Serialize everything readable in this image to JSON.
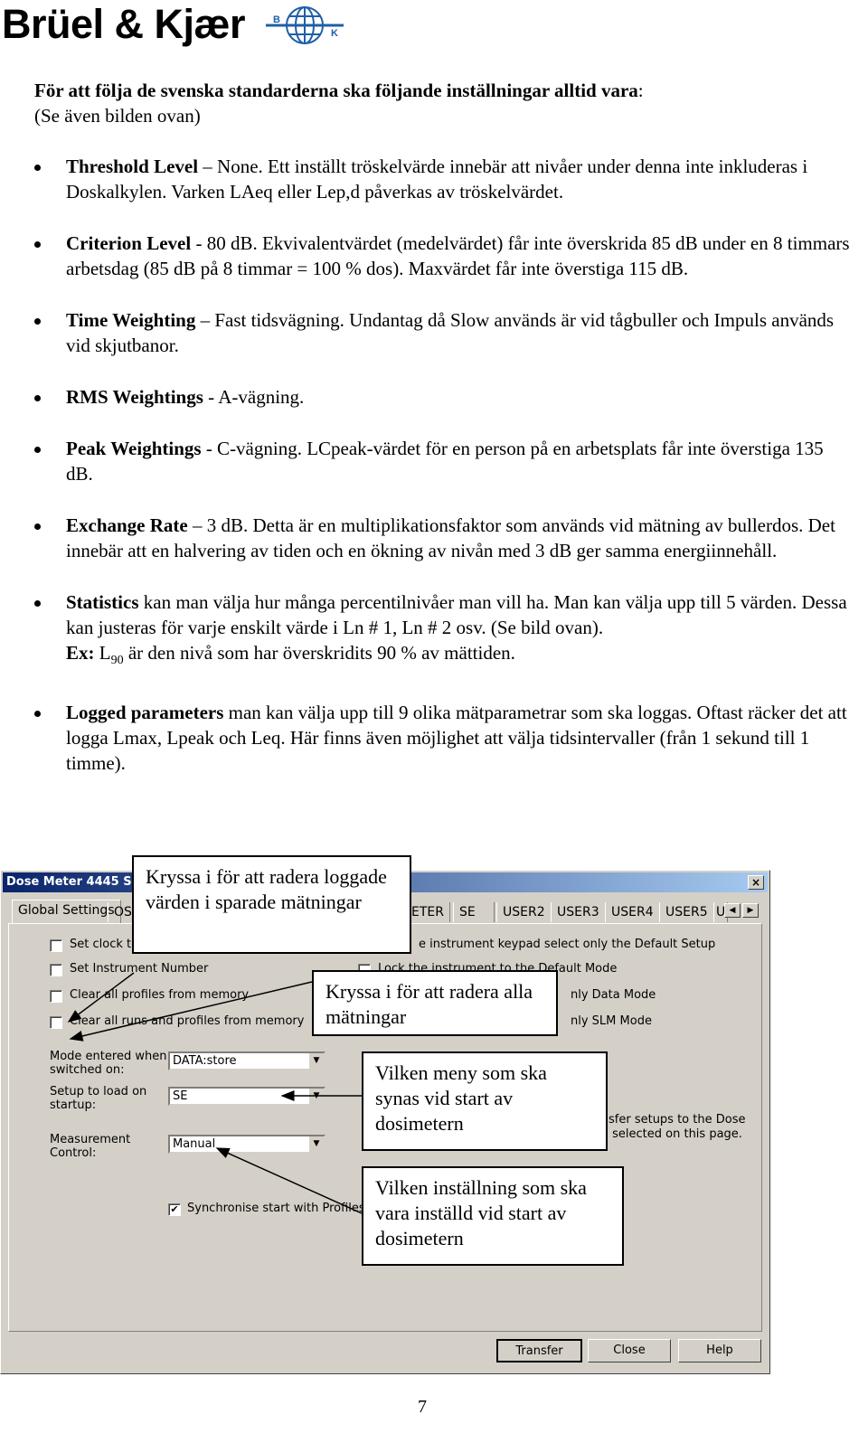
{
  "logo": {
    "text": "Brüel & Kjær",
    "mark_letters": "B K",
    "color": "#1f5fa8"
  },
  "intro": {
    "line1": "För att följa de svenska standarderna ska följande inställningar alltid vara",
    "line1_colon": ":",
    "line2": "(Se även bilden ovan)"
  },
  "bullets": [
    {
      "term": "Threshold Level",
      "text": " – None. Ett inställt tröskelvärde innebär att nivåer under denna inte inkluderas i Doskalkylen. Varken LAeq eller Lep,d påverkas av tröskelvärdet."
    },
    {
      "term": "Criterion Level",
      "text": " - 80 dB. Ekvivalentvärdet (medelvärdet) får inte överskrida 85 dB under en 8 timmars arbetsdag (85 dB på 8 timmar = 100 % dos). Maxvärdet får inte överstiga 115 dB."
    },
    {
      "term": "Time Weighting",
      "text": " – Fast tidsvägning. Undantag då Slow används är vid tågbuller och Impuls används vid skjutbanor."
    },
    {
      "term": "RMS Weightings",
      "text": " - A-vägning."
    },
    {
      "term": "Peak Weightings",
      "text": " - C-vägning. LCpeak-värdet för en person på en arbetsplats får inte överstiga 135 dB."
    },
    {
      "term": "Exchange Rate",
      "text": " – 3 dB. Detta är en multiplikationsfaktor som används vid mätning av bullerdos. Det innebär att en halvering av tiden och en ökning av nivån med 3 dB ger samma energiinnehåll."
    },
    {
      "term": "Statistics",
      "text": " kan man välja hur många percentilnivåer man vill ha. Man kan välja upp till 5 värden. Dessa kan justeras för varje enskilt värde i Ln # 1, Ln # 2 osv. (Se bild ovan).",
      "ex_label": "Ex:",
      "ex_L": " L",
      "ex_sub": "90",
      "ex_text": " är den nivå som har överskridits 90 % av mättiden."
    },
    {
      "term": "Logged parameters",
      "text": " man kan välja upp till 9 olika mätparametrar som ska loggas. Oftast räcker det att logga Lmax, Lpeak och Leq. Här finns även möjlighet att välja tidsintervaller (från 1 sekund till 1 timme)."
    }
  ],
  "dialog": {
    "title": "Dose Meter 4445 Se",
    "close_glyph": "×",
    "tabs": [
      "Global Settings",
      "OS",
      "ETER",
      "SE",
      "USER2",
      "USER3",
      "USER4",
      "USER5",
      "U"
    ],
    "scroll_left": "◀",
    "scroll_right": "▶",
    "left_checks": [
      {
        "label": "Set clock to",
        "checked": false
      },
      {
        "label": "Set Instrument Number",
        "checked": false
      },
      {
        "label": "Clear all profiles from memory",
        "checked": false
      },
      {
        "label": "Clear all runs and profiles from memory",
        "checked": false
      }
    ],
    "right_checks": [
      {
        "label": "e instrument keypad select only the Default Setup"
      },
      {
        "label": "Lock the instrument to the Default Mode"
      },
      {
        "label": "nly Data Mode"
      },
      {
        "label": "nly SLM Mode"
      }
    ],
    "fields": [
      {
        "label1": "Mode entered when",
        "label2": "switched on:",
        "value": "DATA:store"
      },
      {
        "label1": "Setup to load on",
        "label2": "startup:",
        "value": "SE"
      },
      {
        "label1": "Measurement",
        "label2": "Control:",
        "value": "Manual"
      }
    ],
    "sync_label": "Synchronise start with Profiles",
    "sync_checked": true,
    "transfer_note1": "sfer setups to the Dose",
    "transfer_note2": "selected on this page.",
    "buttons": {
      "transfer": "Transfer",
      "close": "Close",
      "help": "Help"
    },
    "dropdown_glyph": "▼",
    "check_glyph": "✔"
  },
  "callouts": [
    "Kryssa i för att radera loggade värden i sparade mätningar",
    "Kryssa i för att radera alla mätningar",
    "Vilken meny som ska synas vid start av dosimetern",
    "Vilken inställning som ska vara inställd vid start av dosimetern"
  ],
  "page_number": "7"
}
